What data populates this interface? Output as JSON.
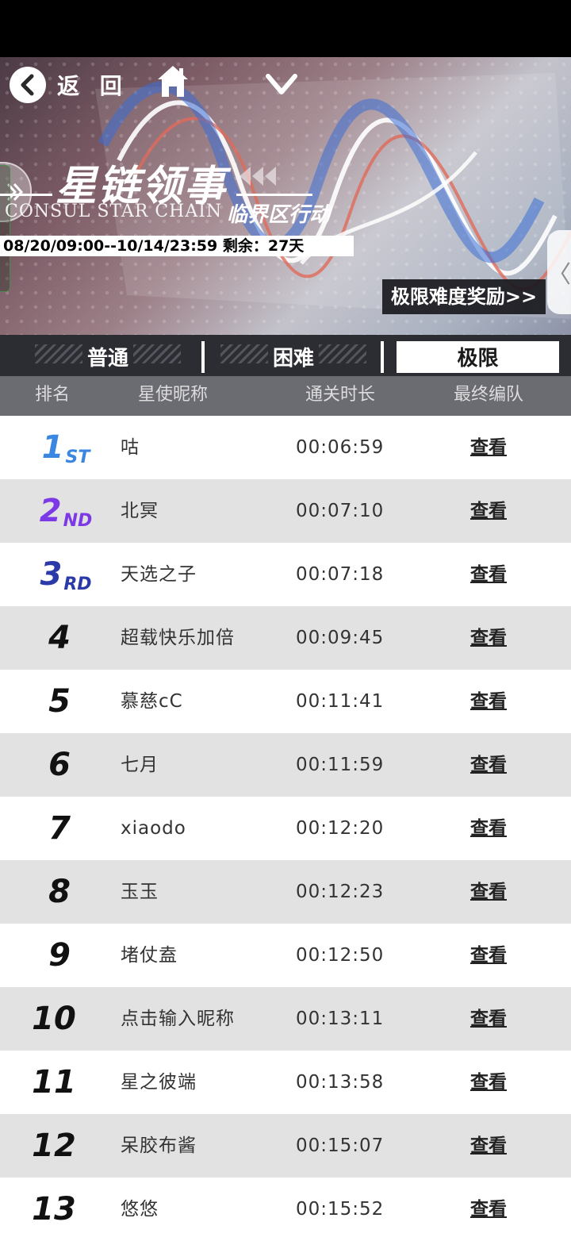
{
  "nav": {
    "back_label": "返 回"
  },
  "banner": {
    "title_cn": "星链领事",
    "subtitle_en": "CONSUL STAR CHAIN",
    "subtitle_cn": "临界区行动",
    "date_range": "08/20/09:00--10/14/23:59 剩余：27天",
    "reward_button": "极限难度奖励>>"
  },
  "tabs": [
    {
      "label": "普通",
      "active": false
    },
    {
      "label": "困难",
      "active": false
    },
    {
      "label": "极限",
      "active": true
    }
  ],
  "table": {
    "headers": [
      "排名",
      "星使昵称",
      "通关时长",
      "最终编队"
    ],
    "view_label": "查看",
    "rows": [
      {
        "rank": "1",
        "suffix": "ST",
        "nickname": "咕",
        "time": "00:06:59"
      },
      {
        "rank": "2",
        "suffix": "ND",
        "nickname": "北冥",
        "time": "00:07:10"
      },
      {
        "rank": "3",
        "suffix": "RD",
        "nickname": "天选之子",
        "time": "00:07:18"
      },
      {
        "rank": "4",
        "suffix": "",
        "nickname": "超载快乐加倍",
        "time": "00:09:45"
      },
      {
        "rank": "5",
        "suffix": "",
        "nickname": "慕慈cC",
        "time": "00:11:41"
      },
      {
        "rank": "6",
        "suffix": "",
        "nickname": "七月",
        "time": "00:11:59"
      },
      {
        "rank": "7",
        "suffix": "",
        "nickname": "xiaodo",
        "time": "00:12:20"
      },
      {
        "rank": "8",
        "suffix": "",
        "nickname": "玉玉",
        "time": "00:12:23"
      },
      {
        "rank": "9",
        "suffix": "",
        "nickname": "堵仗盍",
        "time": "00:12:50"
      },
      {
        "rank": "10",
        "suffix": "",
        "nickname": "点击输入昵称",
        "time": "00:13:11"
      },
      {
        "rank": "11",
        "suffix": "",
        "nickname": "星之彼端",
        "time": "00:13:58"
      },
      {
        "rank": "12",
        "suffix": "",
        "nickname": "呆胶布酱",
        "time": "00:15:07"
      },
      {
        "rank": "13",
        "suffix": "",
        "nickname": "悠悠",
        "time": "00:15:52"
      }
    ]
  },
  "colors": {
    "rank1": "#3a86e0",
    "rank2": "#7b3ae6",
    "rank3": "#2c3aa8",
    "header_bg": "#6b6b72",
    "tabs_bg": "#2c2c33"
  }
}
